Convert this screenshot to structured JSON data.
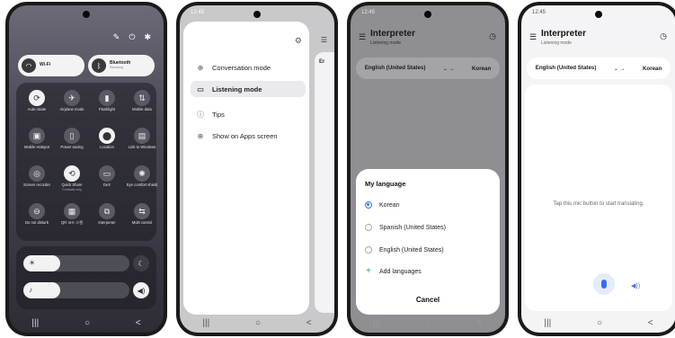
{
  "phone1": {
    "top_icons": [
      "pencil-icon",
      "power-icon",
      "gear-icon"
    ],
    "wifi": {
      "label": "Wi-Fi"
    },
    "bluetooth": {
      "label": "Bluetooth",
      "sub": "Samsung"
    },
    "tiles": [
      {
        "label": "Auto rotate",
        "sub": "",
        "icon": "rotate-icon",
        "on": true
      },
      {
        "label": "Airplane mode",
        "sub": "",
        "icon": "airplane-icon",
        "on": false
      },
      {
        "label": "Flashlight",
        "sub": "",
        "icon": "flashlight-icon",
        "on": false
      },
      {
        "label": "Mobile data",
        "sub": "",
        "icon": "data-arrows-icon",
        "on": false
      },
      {
        "label": "Mobile Hotspot",
        "sub": "",
        "icon": "hotspot-icon",
        "on": false
      },
      {
        "label": "Power saving",
        "sub": "",
        "icon": "battery-icon",
        "on": false
      },
      {
        "label": "Location",
        "sub": "",
        "icon": "location-pin-icon",
        "on": true
      },
      {
        "label": "Link to Windows",
        "sub": "",
        "icon": "link-windows-icon",
        "on": false
      },
      {
        "label": "Screen recorder",
        "sub": "",
        "icon": "screen-record-icon",
        "on": false
      },
      {
        "label": "Quick Share",
        "sub": "Contacts only",
        "icon": "quick-share-icon",
        "on": true
      },
      {
        "label": "DeX",
        "sub": "",
        "icon": "dex-icon",
        "on": false
      },
      {
        "label": "Eye comfort shield",
        "sub": "",
        "icon": "eye-comfort-icon",
        "on": false
      },
      {
        "label": "Do not disturb",
        "sub": "",
        "icon": "do-not-disturb-icon",
        "on": false
      },
      {
        "label": "QR 코드 스캔",
        "sub": "",
        "icon": "qr-scan-icon",
        "on": false
      },
      {
        "label": "Interpreter",
        "sub": "",
        "icon": "interpreter-icon",
        "on": false
      },
      {
        "label": "Multi control",
        "sub": "",
        "icon": "multi-control-icon",
        "on": false
      }
    ],
    "brightness_level": 0.35,
    "volume_level": 0.35,
    "nav": [
      "|||",
      "○",
      "<"
    ]
  },
  "phone2": {
    "time": "12:45",
    "menu": [
      {
        "label": "Conversation mode",
        "icon": "conversation-icon",
        "selected": false
      },
      {
        "label": "Listening mode",
        "icon": "listening-icon",
        "selected": true
      },
      {
        "label": "Tips",
        "icon": "info-icon",
        "selected": false
      },
      {
        "label": "Show on Apps screen",
        "icon": "add-circle-icon",
        "selected": false
      }
    ],
    "peek_label": "Er",
    "nav": [
      "|||",
      "○",
      "<"
    ]
  },
  "phone3": {
    "time": "12:45",
    "title": "Interpreter",
    "subtitle": "Listening mode",
    "source_lang": "English (United States)",
    "target_lang": "Korean",
    "sheet_title": "My language",
    "options": [
      {
        "label": "Korean",
        "selected": true
      },
      {
        "label": "Spanish (United States)",
        "selected": false
      },
      {
        "label": "English (United States)",
        "selected": false
      }
    ],
    "add_label": "Add languages",
    "cancel_label": "Cancel",
    "nav": [
      "|||",
      "○",
      "<"
    ]
  },
  "phone4": {
    "time": "12:45",
    "title": "Interpreter",
    "subtitle": "Listening mode",
    "source_lang": "English (United States)",
    "target_lang": "Korean",
    "hint": "Tap this mic button to start translating.",
    "nav": [
      "|||",
      "○",
      "<"
    ]
  },
  "colors": {
    "accent": "#3a6ee8",
    "add_green": "#2ea86b"
  }
}
